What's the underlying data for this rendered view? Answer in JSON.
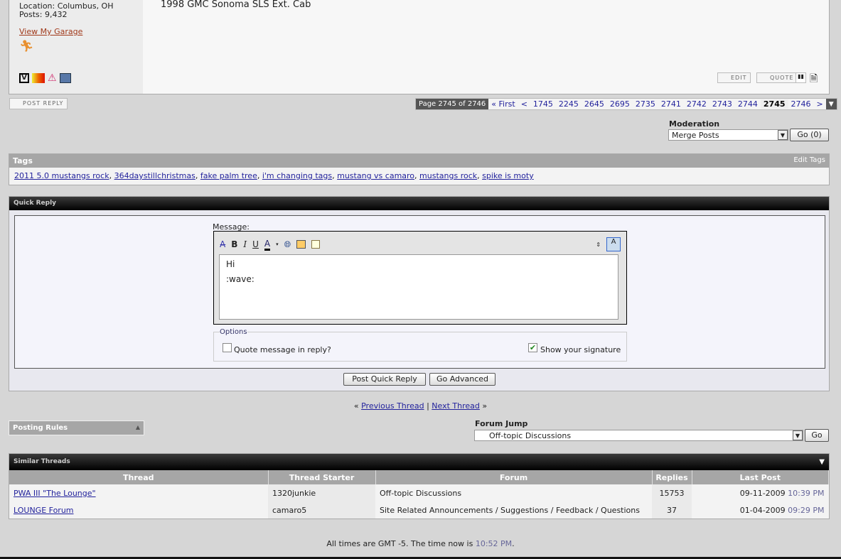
{
  "post": {
    "location": "Location: Columbus, OH",
    "posts": "Posts: 9,432",
    "garage_link": "View My Garage",
    "signature": "1998 GMC Sonoma SLS Ext. Cab",
    "edit": "EDIT",
    "quote": "QUOTE"
  },
  "post_reply": "POST REPLY",
  "pagination": {
    "label": "Page 2745 of 2746",
    "first": "« First",
    "prev": "<",
    "pages": [
      "1745",
      "2245",
      "2645",
      "2695",
      "2735",
      "2741",
      "2742",
      "2743",
      "2744",
      "2745",
      "2746"
    ],
    "current": "2745",
    "next": ">"
  },
  "moderation": {
    "title": "Moderation",
    "selected": "Merge Posts",
    "go": "Go (0)"
  },
  "tags": {
    "title": "Tags",
    "edit": "Edit Tags",
    "items": [
      "2011 5.0 mustangs rock",
      "364daystillchristmas",
      "fake palm tree",
      "i'm changing tags",
      "mustang vs camaro",
      "mustangs rock",
      "spike is moty"
    ]
  },
  "quick_reply": {
    "title": "Quick Reply",
    "message_label": "Message:",
    "line1": "Hi",
    "line2": ":wave:",
    "options_label": "Options",
    "quote_label": "Quote message in reply?",
    "quote_checked": false,
    "sig_label": "Show your signature",
    "sig_checked": true,
    "post_btn": "Post Quick Reply",
    "advanced_btn": "Go Advanced"
  },
  "thread_nav": {
    "prev": "Previous Thread",
    "next": "Next Thread",
    "sep": "|",
    "lq": "«",
    "rq": "»"
  },
  "posting_rules": "Posting Rules",
  "forum_jump": {
    "title": "Forum Jump",
    "selected": "Off-topic Discussions",
    "go": "Go"
  },
  "similar": {
    "title": "Similar Threads",
    "columns": [
      "Thread",
      "Thread Starter",
      "Forum",
      "Replies",
      "Last Post"
    ],
    "rows": [
      {
        "thread": "PWA III \"The Lounge\"",
        "starter": "1320junkie",
        "forum": "Off-topic Discussions",
        "replies": "15753",
        "date": "09-11-2009",
        "time": "10:39 PM"
      },
      {
        "thread": "LOUNGE Forum",
        "starter": "camaro5",
        "forum": "Site Related Announcements / Suggestions / Feedback / Questions",
        "replies": "37",
        "date": "01-04-2009",
        "time": "09:29 PM"
      }
    ]
  },
  "footer": {
    "text": "All times are GMT -5. The time now is",
    "time": "10:52 PM",
    "dot": "."
  }
}
